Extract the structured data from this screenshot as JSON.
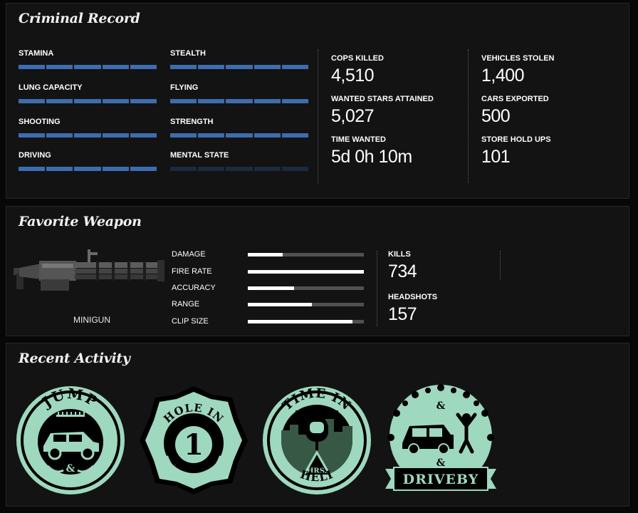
{
  "criminal_record": {
    "title": "Criminal Record",
    "skills": [
      {
        "label": "STAMINA",
        "level": 1.0
      },
      {
        "label": "STEALTH",
        "level": 1.0
      },
      {
        "label": "LUNG CAPACITY",
        "level": 1.0
      },
      {
        "label": "FLYING",
        "level": 1.0
      },
      {
        "label": "SHOOTING",
        "level": 1.0
      },
      {
        "label": "STRENGTH",
        "level": 1.0
      },
      {
        "label": "DRIVING",
        "level": 1.0
      },
      {
        "label": "MENTAL STATE",
        "level": 0.0
      }
    ],
    "stats": [
      {
        "label": "COPS KILLED",
        "value": "4,510"
      },
      {
        "label": "WANTED STARS ATTAINED",
        "value": "5,027"
      },
      {
        "label": "TIME WANTED",
        "value": "5d 0h 10m"
      },
      {
        "label": "VEHICLES STOLEN",
        "value": "1,400"
      },
      {
        "label": "CARS EXPORTED",
        "value": "500"
      },
      {
        "label": "STORE HOLD UPS",
        "value": "101"
      }
    ]
  },
  "favorite_weapon": {
    "title": "Favorite Weapon",
    "name": "MINIGUN",
    "stats": [
      {
        "label": "DAMAGE",
        "level": 0.3
      },
      {
        "label": "FIRE RATE",
        "level": 1.0
      },
      {
        "label": "ACCURACY",
        "level": 0.4
      },
      {
        "label": "RANGE",
        "level": 0.55
      },
      {
        "label": "CLIP SIZE",
        "level": 0.9
      }
    ],
    "kills_label": "KILLS",
    "kills_value": "734",
    "headshots_label": "HEADSHOTS",
    "headshots_value": "157"
  },
  "recent_activity": {
    "title": "Recent Activity",
    "badges": [
      {
        "icon": "jump-badge-icon",
        "top_text": "JUMP"
      },
      {
        "icon": "hole-in-1-badge-icon",
        "top_text": "HOLE IN",
        "center_text": "1"
      },
      {
        "icon": "time-in-heli-badge-icon",
        "top_text": "TIME IN",
        "mid_text": "HRS.",
        "bottom_text": "HELI"
      },
      {
        "icon": "driveby-badge-icon",
        "banner_text": "DRIVEBY"
      }
    ]
  },
  "colors": {
    "skill_bar": "#3c6db1",
    "badge_mint": "#9ed8be",
    "panel_bg": "#131313"
  }
}
